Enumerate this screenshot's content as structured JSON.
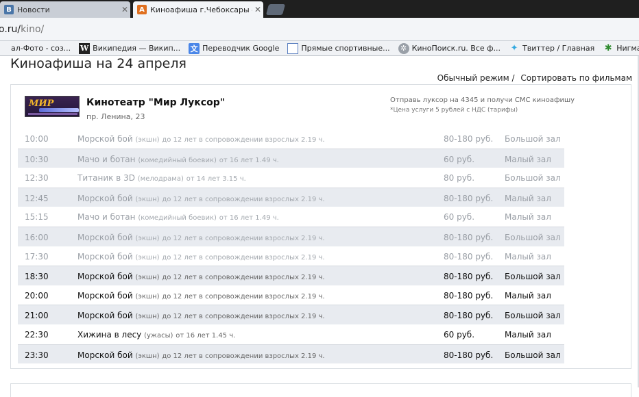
{
  "browser": {
    "tabs": [
      {
        "title": "Новости",
        "icon": "vk-icon",
        "icon_color": "#4a76a8",
        "active": false
      },
      {
        "title": "Киноафиша г.Чебоксары - р",
        "icon": "afisha-icon",
        "icon_color": "#e07020",
        "active": true
      }
    ],
    "url_host": "o.ru/",
    "url_path": "kino/",
    "bookmarks": [
      {
        "label": "ал-Фото - coз...",
        "icon": "photo-icon"
      },
      {
        "label": "Википедия — Викип...",
        "icon": "wikipedia-icon"
      },
      {
        "label": "Переводчик Google",
        "icon": "google-translate-icon"
      },
      {
        "label": "Прямые спортивные...",
        "icon": "page-icon"
      },
      {
        "label": "КиноПоиск.ru. Все ф...",
        "icon": "film-reel-icon"
      },
      {
        "label": "Твиттер / Главная",
        "icon": "twitter-icon"
      },
      {
        "label": "Нигма - интеллекту...",
        "icon": "nigma-icon"
      }
    ]
  },
  "page": {
    "heading": "Киноафиша на 24 апреля",
    "modes": {
      "normal": "Обычный режим",
      "separator": "/",
      "sort_by_film": "Сортировать по фильмам"
    },
    "cinema": {
      "name": "Кинотеатр \"Мир Луксор\"",
      "address": "пр. Ленина, 23",
      "logo_text": "МИР",
      "sms_text": "Отправь луксор на 4345 и получи СМС киноафишу",
      "sms_note": "*Цена услуги 5 рублей с НДС (тарифы)"
    },
    "sessions": [
      {
        "time": "10:00",
        "film": "Морской бой",
        "genre": "(экшн)",
        "age": "до 12 лет в сопровождении взрослых 2.19 ч.",
        "price": "80-180 руб.",
        "hall": "Большой зал",
        "past": true
      },
      {
        "time": "10:30",
        "film": "Мачо и ботан",
        "genre": "(комедийный боевик)",
        "age": "от 16 лет 1.49 ч.",
        "price": "60 руб.",
        "hall": "Малый зал",
        "past": true
      },
      {
        "time": "12:30",
        "film": "Титаник в 3D",
        "genre": "(мелодрама)",
        "age": "от 14 лет 3.15 ч.",
        "price": "80 руб.",
        "hall": "Большой зал",
        "past": true
      },
      {
        "time": "12:45",
        "film": "Морской бой",
        "genre": "(экшн)",
        "age": "до 12 лет в сопровождении взрослых 2.19 ч.",
        "price": "80-180 руб.",
        "hall": "Малый зал",
        "past": true
      },
      {
        "time": "15:15",
        "film": "Мачо и ботан",
        "genre": "(комедийный боевик)",
        "age": "от 16 лет 1.49 ч.",
        "price": "60 руб.",
        "hall": "Малый зал",
        "past": true
      },
      {
        "time": "16:00",
        "film": "Морской бой",
        "genre": "(экшн)",
        "age": "до 12 лет в сопровождении взрослых 2.19 ч.",
        "price": "80-180 руб.",
        "hall": "Большой зал",
        "past": true
      },
      {
        "time": "17:30",
        "film": "Морской бой",
        "genre": "(экшн)",
        "age": "до 12 лет в сопровождении взрослых 2.19 ч.",
        "price": "80-180 руб.",
        "hall": "Малый зал",
        "past": true
      },
      {
        "time": "18:30",
        "film": "Морской бой",
        "genre": "(экшн)",
        "age": "до 12 лет в сопровождении взрослых 2.19 ч.",
        "price": "80-180 руб.",
        "hall": "Большой зал",
        "past": false
      },
      {
        "time": "20:00",
        "film": "Морской бой",
        "genre": "(экшн)",
        "age": "до 12 лет в сопровождении взрослых 2.19 ч.",
        "price": "80-180 руб.",
        "hall": "Малый зал",
        "past": false
      },
      {
        "time": "21:00",
        "film": "Морской бой",
        "genre": "(экшн)",
        "age": "до 12 лет в сопровождении взрослых 2.19 ч.",
        "price": "80-180 руб.",
        "hall": "Большой зал",
        "past": false
      },
      {
        "time": "22:30",
        "film": "Хижина в лесу",
        "genre": "(ужасы)",
        "age": "от 16 лет 1.45 ч.",
        "price": "60 руб.",
        "hall": "Малый зал",
        "past": false
      },
      {
        "time": "23:30",
        "film": "Морской бой",
        "genre": "(экшн)",
        "age": "до 12 лет в сопровождении взрослых 2.19 ч.",
        "price": "80-180 руб.",
        "hall": "Большой зал",
        "past": false
      }
    ]
  }
}
